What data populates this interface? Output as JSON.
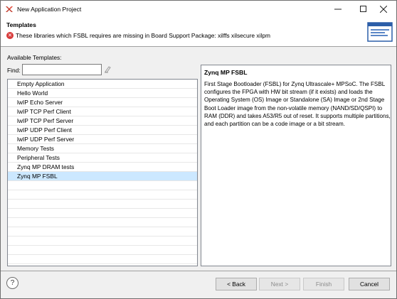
{
  "window": {
    "title": "New Application Project",
    "icon": "xilinx-logo-icon",
    "controls": [
      "minimize-icon",
      "maximize-icon",
      "close-icon"
    ]
  },
  "banner": {
    "title": "Templates",
    "message": "These libraries which FSBL requires are missing in Board Support Package: xilffs xilsecure xilpm",
    "message_icon": "error-icon",
    "message_color": "#d83b3b"
  },
  "available": {
    "label": "Available Templates:",
    "find_label": "Find:",
    "find_value": "",
    "clear_icon": "clear-icon"
  },
  "templates": [
    {
      "label": "Empty Application",
      "selected": false
    },
    {
      "label": "Hello World",
      "selected": false
    },
    {
      "label": "lwIP Echo Server",
      "selected": false
    },
    {
      "label": "lwIP TCP Perf Client",
      "selected": false
    },
    {
      "label": "lwIP TCP Perf Server",
      "selected": false
    },
    {
      "label": "lwIP UDP Perf Client",
      "selected": false
    },
    {
      "label": "lwIP UDP Perf Server",
      "selected": false
    },
    {
      "label": "Memory Tests",
      "selected": false
    },
    {
      "label": "Peripheral Tests",
      "selected": false
    },
    {
      "label": "Zynq MP DRAM tests",
      "selected": false
    },
    {
      "label": "Zynq MP FSBL",
      "selected": true
    }
  ],
  "description": {
    "title": "Zynq MP FSBL",
    "text": "First Stage Bootloader (FSBL) for Zynq Ultrascale+ MPSoC. The FSBL configures the FPGA with HW bit stream (if it exists)  and loads the Operating System (OS) Image or Standalone (SA) Image or 2nd Stage Boot Loader image from the  non-volatile memory (NAND/SD/QSPI) to RAM (DDR) and takes A53/R5 out of reset.  It supports multiple partitions,  and each partition can be a code image or a bit stream."
  },
  "footer": {
    "help_icon": "help-icon",
    "back_label": "< Back",
    "next_label": "Next >",
    "finish_label": "Finish",
    "cancel_label": "Cancel"
  },
  "colors": {
    "selection": "#cce8ff",
    "error": "#d83b3b"
  }
}
